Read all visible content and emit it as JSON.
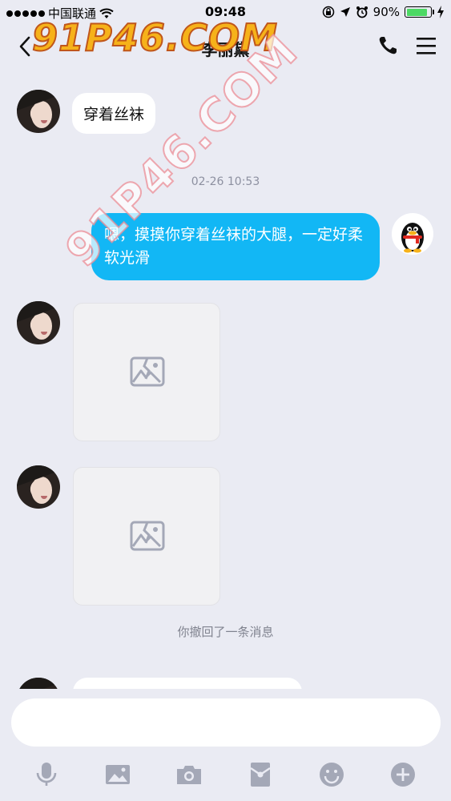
{
  "status_bar": {
    "carrier": "中国联通",
    "time": "09:48",
    "battery": "90%",
    "battery_level": 0.9
  },
  "header": {
    "title": "李丽黛"
  },
  "watermark": {
    "text": "91P46.COM"
  },
  "messages": {
    "m1_text": "穿着丝袜",
    "time1": "02-26 10:53",
    "m2_text": "嗯，摸摸你穿着丝袜的大腿，一定好柔软光滑",
    "recall_notice": "你撤回了一条消息"
  },
  "input": {
    "placeholder": ""
  },
  "colors": {
    "accent": "#12b7f5",
    "background": "#eaebf3",
    "icon": "#a4a8b7"
  },
  "icons": {
    "back": "chevron-left-icon",
    "call": "phone-icon",
    "menu": "menu-icon",
    "voice": "microphone-icon",
    "image": "image-icon",
    "camera": "camera-icon",
    "red_packet": "red-packet-icon",
    "emoji": "emoji-icon",
    "plus": "plus-icon"
  }
}
